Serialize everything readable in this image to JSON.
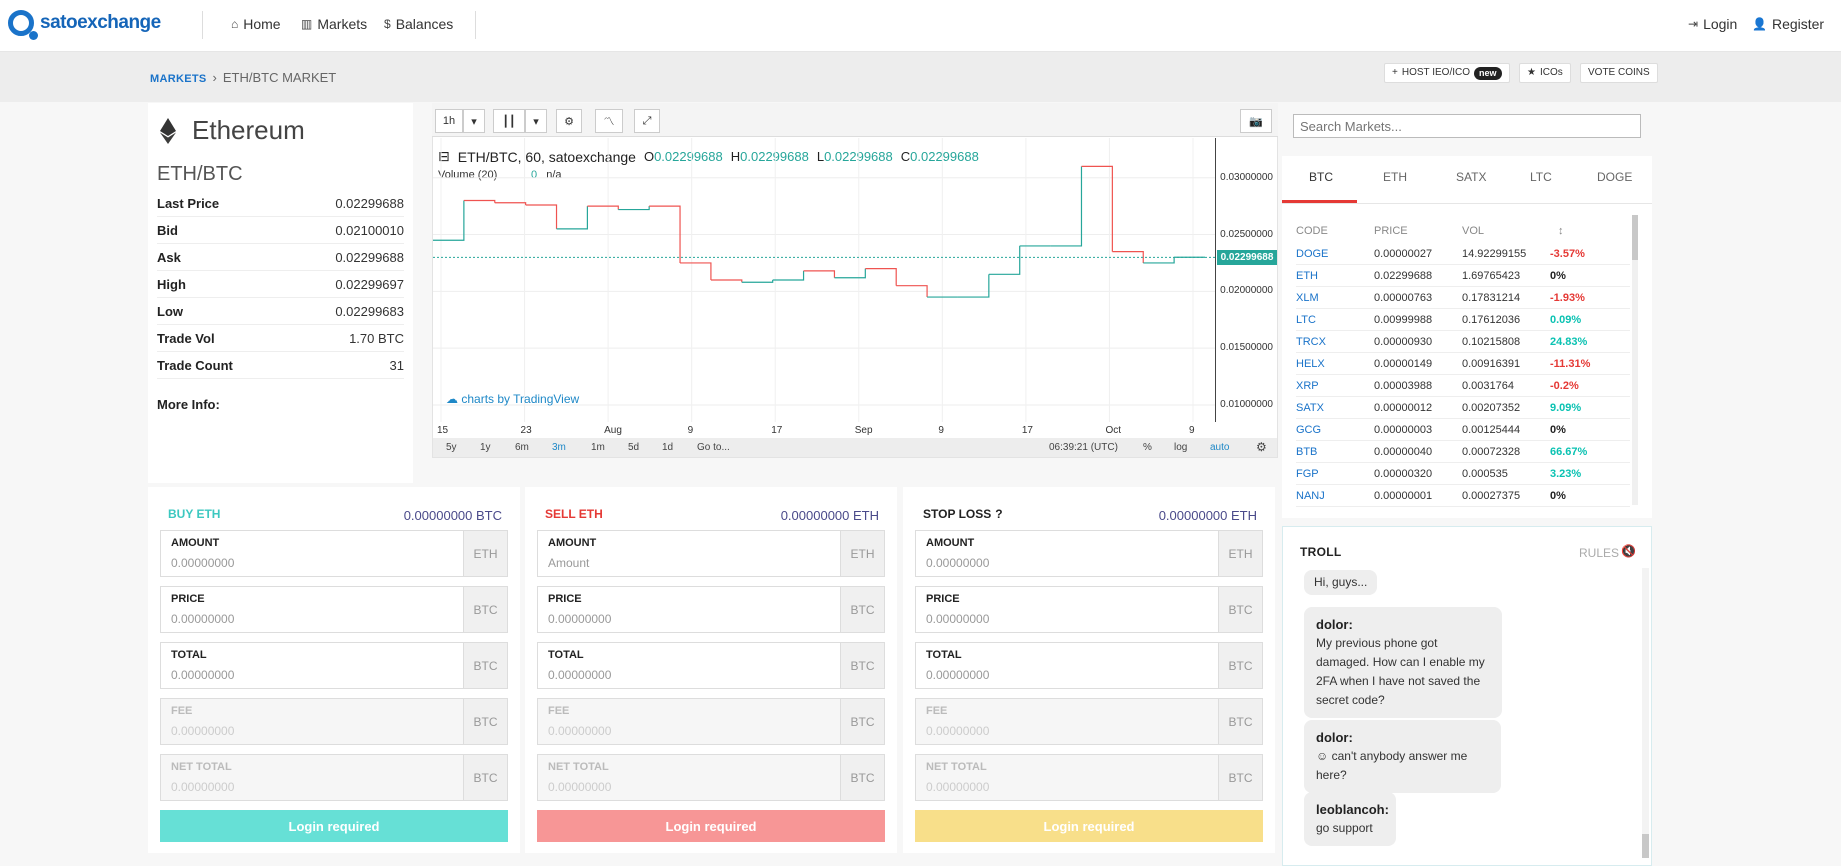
{
  "brand": {
    "logo_text": "satoexchange"
  },
  "nav": {
    "home": "Home",
    "markets": "Markets",
    "balances": "Balances",
    "login": "Login",
    "register": "Register"
  },
  "breadcrumb": {
    "markets": "MARKETS",
    "current": "ETH/BTC MARKET"
  },
  "actions": {
    "host": "HOST IEO/ICO",
    "new_badge": "new",
    "icos": "ICOs",
    "vote": "VOTE COINS"
  },
  "coin": {
    "name": "Ethereum",
    "pair": "ETH/BTC",
    "stats": [
      {
        "label": "Last Price",
        "value": "0.02299688"
      },
      {
        "label": "Bid",
        "value": "0.02100010"
      },
      {
        "label": "Ask",
        "value": "0.02299688"
      },
      {
        "label": "High",
        "value": "0.02299697"
      },
      {
        "label": "Low",
        "value": "0.02299683"
      },
      {
        "label": "Trade Vol",
        "value": "1.70 BTC"
      },
      {
        "label": "Trade Count",
        "value": "31"
      }
    ],
    "more_info": "More Info:"
  },
  "chart_toolbar": {
    "interval": "1h"
  },
  "chart_data": {
    "type": "line",
    "title": "ETH/BTC, 60, satoexchange",
    "ohlc": {
      "O": "0.02299688",
      "H": "0.02299688",
      "L": "0.02299688",
      "C": "0.02299688"
    },
    "volume_label": "Volume (20)",
    "volume_value": "0",
    "volume_extra": "n/a",
    "last_price_label": "0.02299688",
    "yticks": [
      "0.03000000",
      "0.02500000",
      "0.02000000",
      "0.01500000",
      "0.01000000"
    ],
    "ylim": [
      0.0085,
      0.0335
    ],
    "xticks": [
      "15",
      "23",
      "Aug",
      "9",
      "17",
      "Sep",
      "9",
      "17",
      "Oct",
      "9"
    ],
    "x": [
      0,
      4,
      8,
      12,
      16,
      20,
      24,
      28,
      32,
      36,
      40,
      44,
      48,
      52,
      56,
      60,
      64,
      68,
      72,
      76,
      80,
      84,
      88,
      92,
      96,
      100
    ],
    "values": [
      0.0245,
      0.028,
      0.0278,
      0.0276,
      0.0255,
      0.0275,
      0.0272,
      0.0275,
      0.0225,
      0.021,
      0.0208,
      0.021,
      0.0218,
      0.0212,
      0.022,
      0.0205,
      0.0195,
      0.0195,
      0.0215,
      0.024,
      0.024,
      0.031,
      0.0235,
      0.0225,
      0.023,
      0.023
    ],
    "ranges": [
      "5y",
      "1y",
      "6m",
      "3m",
      "1m",
      "5d",
      "1d"
    ],
    "goto": "Go to...",
    "time": "06:39:21 (UTC)",
    "pct": "%",
    "log": "log",
    "auto": "auto",
    "watermark": "charts by TradingView"
  },
  "markets_panel": {
    "search_placeholder": "Search Markets...",
    "tabs": [
      "BTC",
      "ETH",
      "SATX",
      "LTC",
      "DOGE"
    ],
    "columns": [
      "CODE",
      "PRICE",
      "VOL",
      "↕"
    ],
    "rows": [
      {
        "code": "DOGE",
        "price": "0.00000027",
        "vol": "14.92299155",
        "change": "-3.57%",
        "dir": "dn"
      },
      {
        "code": "ETH",
        "price": "0.02299688",
        "vol": "1.69765423",
        "change": "0%",
        "dir": "zr"
      },
      {
        "code": "XLM",
        "price": "0.00000763",
        "vol": "0.17831214",
        "change": "-1.93%",
        "dir": "dn"
      },
      {
        "code": "LTC",
        "price": "0.00999988",
        "vol": "0.17612036",
        "change": "0.09%",
        "dir": "up"
      },
      {
        "code": "TRCX",
        "price": "0.00000930",
        "vol": "0.10215808",
        "change": "24.83%",
        "dir": "up"
      },
      {
        "code": "HELX",
        "price": "0.00000149",
        "vol": "0.00916391",
        "change": "-11.31%",
        "dir": "dn"
      },
      {
        "code": "XRP",
        "price": "0.00003988",
        "vol": "0.0031764",
        "change": "-0.2%",
        "dir": "dn"
      },
      {
        "code": "SATX",
        "price": "0.00000012",
        "vol": "0.00207352",
        "change": "9.09%",
        "dir": "up"
      },
      {
        "code": "GCG",
        "price": "0.00000003",
        "vol": "0.00125444",
        "change": "0%",
        "dir": "zr"
      },
      {
        "code": "BTB",
        "price": "0.00000040",
        "vol": "0.00072328",
        "change": "66.67%",
        "dir": "up"
      },
      {
        "code": "FGP",
        "price": "0.00000320",
        "vol": "0.000535",
        "change": "3.23%",
        "dir": "up"
      },
      {
        "code": "NANJ",
        "price": "0.00000001",
        "vol": "0.00027375",
        "change": "0%",
        "dir": "zr"
      }
    ]
  },
  "troll": {
    "title": "TROLL",
    "rules": "RULES",
    "messages": [
      {
        "user": "",
        "text": "Hi, guys..."
      },
      {
        "user": "dolor:",
        "text": "My previous phone got damaged. How can I enable my 2FA when I have not saved the secret code?"
      },
      {
        "user": "dolor:",
        "text": "can't anybody answer me here?"
      },
      {
        "user": "leoblancoh:",
        "text": "go support"
      }
    ]
  },
  "orders": [
    {
      "title": "BUY ETH",
      "balance": "0.00000000 BTC",
      "color": "#3cc8c0",
      "button_color": "#66e0d6",
      "button": "Login required",
      "fields": [
        {
          "label": "AMOUNT",
          "placeholder": "0.00000000",
          "unit": "ETH",
          "disabled": false
        },
        {
          "label": "PRICE",
          "placeholder": "0.00000000",
          "unit": "BTC",
          "disabled": false
        },
        {
          "label": "TOTAL",
          "placeholder": "0.00000000",
          "unit": "BTC",
          "disabled": false
        },
        {
          "label": "FEE",
          "placeholder": "0.00000000",
          "unit": "BTC",
          "disabled": true
        },
        {
          "label": "NET TOTAL",
          "placeholder": "0.00000000",
          "unit": "BTC",
          "disabled": true
        }
      ]
    },
    {
      "title": "SELL ETH",
      "balance": "0.00000000 ETH",
      "color": "#e53935",
      "button_color": "#f79696",
      "button": "Login required",
      "fields": [
        {
          "label": "AMOUNT",
          "placeholder": "Amount",
          "unit": "ETH",
          "disabled": false
        },
        {
          "label": "PRICE",
          "placeholder": "0.00000000",
          "unit": "BTC",
          "disabled": false
        },
        {
          "label": "TOTAL",
          "placeholder": "0.00000000",
          "unit": "BTC",
          "disabled": false
        },
        {
          "label": "FEE",
          "placeholder": "0.00000000",
          "unit": "BTC",
          "disabled": true
        },
        {
          "label": "NET TOTAL",
          "placeholder": "0.00000000",
          "unit": "BTC",
          "disabled": true
        }
      ]
    },
    {
      "title": "STOP LOSS",
      "balance": "0.00000000 ETH",
      "color": "#222222",
      "button_color": "#f8df8a",
      "button": "Login required",
      "fields": [
        {
          "label": "AMOUNT",
          "placeholder": "0.00000000",
          "unit": "ETH",
          "disabled": false
        },
        {
          "label": "PRICE",
          "placeholder": "0.00000000",
          "unit": "BTC",
          "disabled": false
        },
        {
          "label": "TOTAL",
          "placeholder": "0.00000000",
          "unit": "BTC",
          "disabled": false
        },
        {
          "label": "FEE",
          "placeholder": "0.00000000",
          "unit": "BTC",
          "disabled": true
        },
        {
          "label": "NET TOTAL",
          "placeholder": "0.00000000",
          "unit": "BTC",
          "disabled": true
        }
      ]
    }
  ]
}
